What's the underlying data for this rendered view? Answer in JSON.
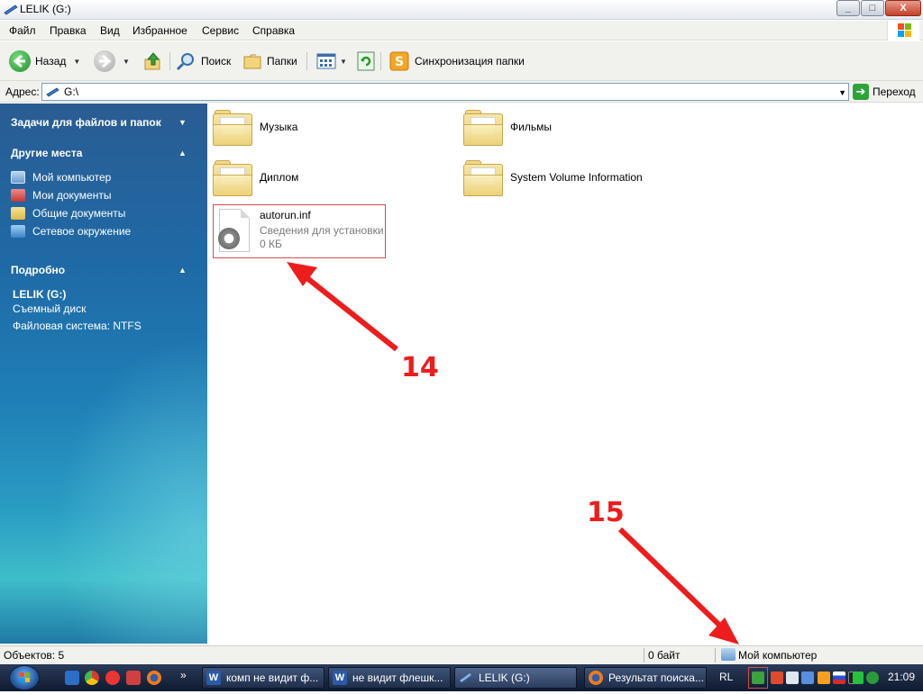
{
  "window": {
    "title": "LELIK (G:)",
    "controls": {
      "minimize": "_",
      "maximize": "□",
      "close": "X"
    }
  },
  "menu": [
    "Файл",
    "Правка",
    "Вид",
    "Избранное",
    "Сервис",
    "Справка"
  ],
  "toolbar": {
    "back": "Назад",
    "search": "Поиск",
    "folders": "Папки",
    "sync": "Синхронизация папки"
  },
  "address": {
    "label": "Адрес:",
    "value": "G:\\",
    "go": "Переход"
  },
  "tasks_pane": {
    "file_tasks": "Задачи для файлов и папок",
    "other_places": {
      "title": "Другие места",
      "items": [
        "Мой компьютер",
        "Мои документы",
        "Общие документы",
        "Сетевое окружение"
      ]
    },
    "details": {
      "title": "Подробно",
      "name": "LELIK (G:)",
      "type": "Съемный диск",
      "fs": "Файловая система: NTFS"
    }
  },
  "folders": [
    "Музыка",
    "Фильмы",
    "Диплом",
    "System Volume Information"
  ],
  "file": {
    "name": "autorun.inf",
    "type": "Сведения для установки",
    "size": "0 КБ"
  },
  "annotations": {
    "a14": "14",
    "a15": "15"
  },
  "status": {
    "objects": "Объектов: 5",
    "size": "0 байт",
    "location": "Мой компьютер"
  },
  "taskbar": {
    "tasks": [
      "комп не видит ф...",
      "не видит флешк...",
      "LELIK (G:)",
      "Результат поиска..."
    ],
    "lang": "RL",
    "time": "21:09"
  },
  "colors": {
    "annotation": "#ee1c1c",
    "pane": "#1f6aa6"
  }
}
